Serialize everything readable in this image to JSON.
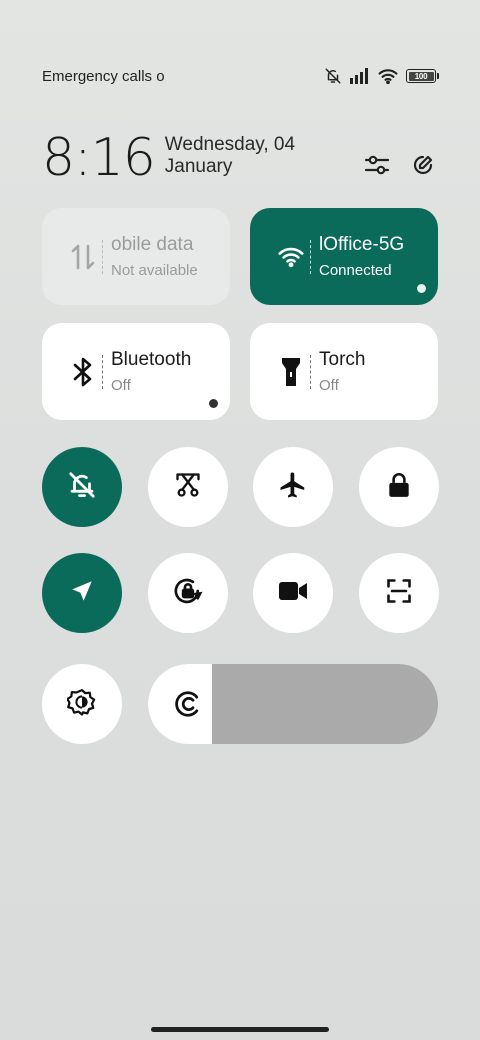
{
  "status_bar": {
    "carrier": "Emergency calls o",
    "battery": "100",
    "battery_level": 1.0
  },
  "clock": {
    "time": "8:16",
    "date": "Wednesday, 04 January"
  },
  "tiles": {
    "mobile_data": {
      "title": "obile data",
      "subtitle": "Not available",
      "icon": "mobile-data-icon",
      "active": false
    },
    "wifi": {
      "title": "lOffice-5G",
      "subtitle": "Connected",
      "icon": "wifi-icon",
      "active": true
    },
    "bluetooth": {
      "title": "Bluetooth",
      "subtitle": "Off",
      "icon": "bluetooth-icon",
      "active": false
    },
    "torch": {
      "title": "Torch",
      "subtitle": "Off",
      "icon": "torch-icon",
      "active": false
    }
  },
  "toggles": [
    {
      "name": "silent",
      "icon": "bell-off-icon",
      "active": true
    },
    {
      "name": "screenshot",
      "icon": "scissors-screenshot-icon",
      "active": false
    },
    {
      "name": "airplane",
      "icon": "airplane-icon",
      "active": false
    },
    {
      "name": "lock",
      "icon": "lock-icon",
      "active": false
    },
    {
      "name": "location",
      "icon": "location-arrow-icon",
      "active": true
    },
    {
      "name": "rotation-lock",
      "icon": "rotation-lock-icon",
      "active": false
    },
    {
      "name": "screen-record",
      "icon": "video-camera-icon",
      "active": false
    },
    {
      "name": "scanner",
      "icon": "scan-frame-icon",
      "active": false
    },
    {
      "name": "auto-brightness",
      "icon": "auto-brightness-icon",
      "active": false
    }
  ],
  "brightness": {
    "level": 0.22,
    "icon": "brightness-icon"
  },
  "colors": {
    "accent": "#0a6b5a",
    "tile_inactive": "#ffffff",
    "tile_disabled": "#e8eae9",
    "slider_track": "#a9aaa9"
  }
}
